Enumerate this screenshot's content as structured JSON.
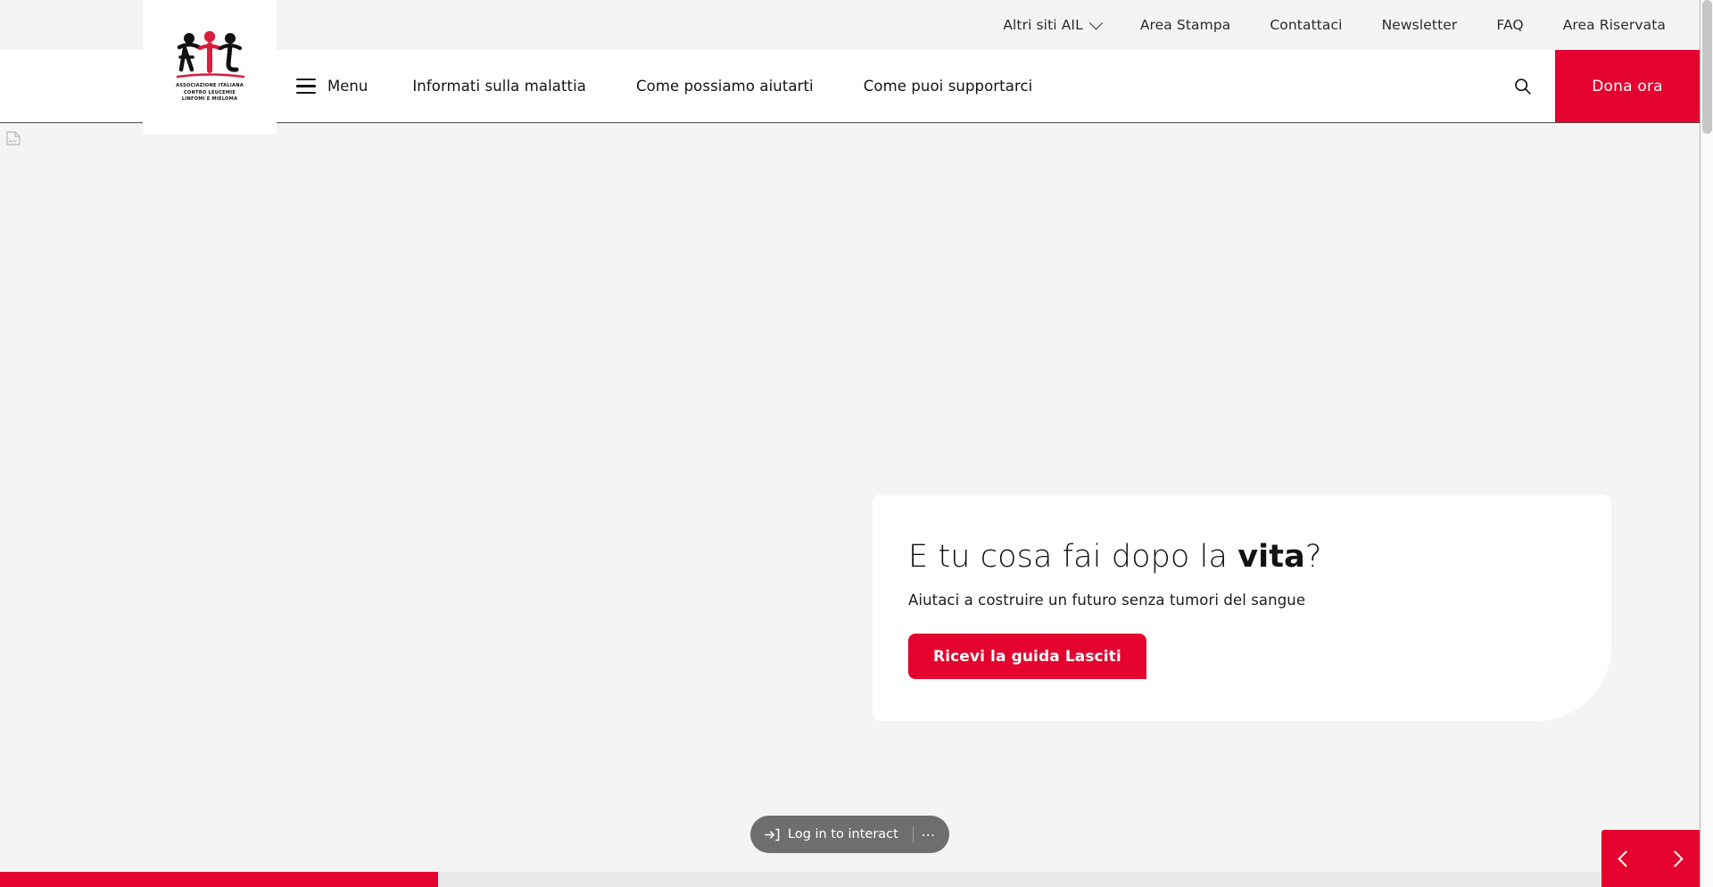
{
  "colors": {
    "brand_red": "#e4032e",
    "topbar_bg": "#f4f4f4",
    "hero_bg": "#f4f4f4",
    "card_bg": "#ffffff",
    "text": "#141414",
    "overlay_pill": "#6e6e6e"
  },
  "topbar": {
    "items": [
      {
        "label": "Altri siti AIL",
        "has_chevron": true,
        "icon": "chevron-down-icon"
      },
      {
        "label": "Area Stampa",
        "has_chevron": false
      },
      {
        "label": "Contattaci",
        "has_chevron": false
      },
      {
        "label": "Newsletter",
        "has_chevron": false
      },
      {
        "label": "FAQ",
        "has_chevron": false
      },
      {
        "label": "Area Riservata",
        "has_chevron": false
      }
    ]
  },
  "logo": {
    "alt": "AIL",
    "line1": "ASSOCIAZIONE ITALIANA",
    "line2": "CONTRO LEUCEMIE",
    "line3": "LINFOMI E MIELOMA"
  },
  "nav": {
    "menu_label": "Menu",
    "menu_icon": "hamburger-icon",
    "items": [
      {
        "label": "Informati sulla malattia"
      },
      {
        "label": "Come possiamo aiutarti"
      },
      {
        "label": "Come puoi supportarci"
      }
    ],
    "search_icon": "search-icon",
    "donate_label": "Dona ora"
  },
  "hero": {
    "broken_image_icon": "broken-image-icon",
    "title_prefix": "E tu cosa fai dopo la ",
    "title_bold": "vita",
    "title_suffix": "?",
    "subtitle": "Aiutaci a costruire un futuro senza tumori del sangue",
    "cta_label": "Ricevi la guida Lasciti"
  },
  "overlay": {
    "login_label": "Log in to interact",
    "login_icon": "login-arrow-icon",
    "more_label": "⋯",
    "more_icon": "ellipsis-icon"
  },
  "carousel": {
    "prev_icon": "chevron-left-icon",
    "next_icon": "chevron-right-icon"
  },
  "progress": {
    "percent": 25.8
  }
}
